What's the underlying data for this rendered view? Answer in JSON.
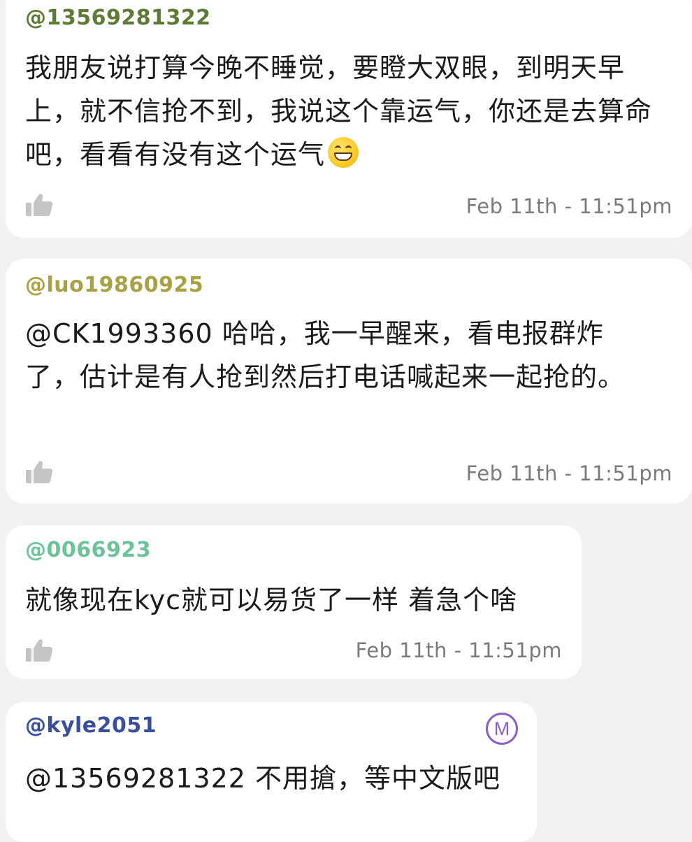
{
  "comments": [
    {
      "username": "@13569281322",
      "username_color": "#5f7a35",
      "message": "我朋友说打算今晚不睡觉，要瞪大双眼，到明天早上，就不信抢不到，我说这个靠运气，你还是去算命吧，看看有没有这个运气",
      "emoji_icon": "grinning-face-icon",
      "timestamp": "Feb 11th - 11:51pm",
      "like_icon": "thumbs-up-icon"
    },
    {
      "username": "@luo19860925",
      "username_color": "#a8a245",
      "message": "@CK1993360 哈哈，我一早醒来，看电报群炸了，估计是有人抢到然后打电话喊起来一起抢的。",
      "timestamp": "Feb 11th - 11:51pm",
      "like_icon": "thumbs-up-icon"
    },
    {
      "username": "@0066923",
      "username_color": "#6cc39a",
      "message": "就像现在kyc就可以易货了一样 着急个啥",
      "timestamp": "Feb 11th - 11:51pm",
      "like_icon": "thumbs-up-icon"
    },
    {
      "username": "@kyle2051",
      "username_color": "#3a4f9a",
      "message": "@13569281322 不用搶，等中文版吧",
      "badge_icon": "moderator-m-badge-icon",
      "badge_color": "#8a5fc7",
      "badge_letter": "M"
    }
  ],
  "colors": {
    "background": "#f1f1f1",
    "card": "#ffffff",
    "text": "#1b1b1b",
    "timestamp": "#7a7a7a",
    "like_icon": "#c4c4c4"
  }
}
